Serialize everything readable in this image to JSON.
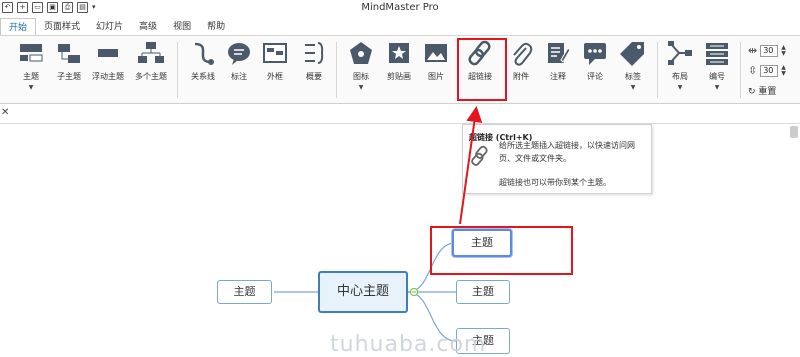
{
  "titlebar": {
    "app_title": "MindMaster Pro",
    "qat_icons": [
      "undo-icon",
      "new-icon",
      "open-icon",
      "save-icon",
      "print-icon",
      "export-icon",
      "dropdown-icon"
    ]
  },
  "tabs": [
    {
      "label": "开始",
      "active": true
    },
    {
      "label": "页面样式"
    },
    {
      "label": "幻灯片"
    },
    {
      "label": "高级"
    },
    {
      "label": "视图"
    },
    {
      "label": "帮助"
    }
  ],
  "ribbon": {
    "buttons": [
      {
        "label": "主题",
        "icon": "topic-icon"
      },
      {
        "label": "子主题",
        "icon": "subtopic-icon"
      },
      {
        "label": "浮动主题",
        "icon": "floating-topic-icon"
      },
      {
        "label": "多个主题",
        "icon": "multiple-topics-icon"
      },
      {
        "label": "关系线",
        "icon": "relationship-icon"
      },
      {
        "label": "标注",
        "icon": "callout-icon"
      },
      {
        "label": "外框",
        "icon": "boundary-icon"
      },
      {
        "label": "概要",
        "icon": "summary-icon"
      },
      {
        "label": "图标",
        "icon": "mark-icon"
      },
      {
        "label": "剪贴画",
        "icon": "clipart-icon"
      },
      {
        "label": "图片",
        "icon": "picture-icon"
      },
      {
        "label": "超链接",
        "icon": "hyperlink-icon"
      },
      {
        "label": "附件",
        "icon": "attachment-icon"
      },
      {
        "label": "注释",
        "icon": "note-icon"
      },
      {
        "label": "评论",
        "icon": "comment-icon"
      },
      {
        "label": "标签",
        "icon": "tag-icon"
      },
      {
        "label": "布局",
        "icon": "layout-icon"
      },
      {
        "label": "编号",
        "icon": "numbering-icon"
      }
    ],
    "spacing_h": "30",
    "spacing_v": "30",
    "reset_label": "重置"
  },
  "tooltip": {
    "title": "超链接 (Ctrl+K)",
    "description": "给所选主题插入超链接，以快速访问网页、文件或文件夹。",
    "extra": "超链接也可以带你到某个主题。"
  },
  "mindmap": {
    "central": "中心主题",
    "left_topic": "主题",
    "right_topics": [
      "主题",
      "主题",
      "主题"
    ]
  },
  "watermark": "tuhuaba.com",
  "colors": {
    "accent": "#1a6fb0",
    "annotation_red": "#e3161e",
    "node_border": "#7aa8cf",
    "central_fill": "#e8f2fb"
  }
}
